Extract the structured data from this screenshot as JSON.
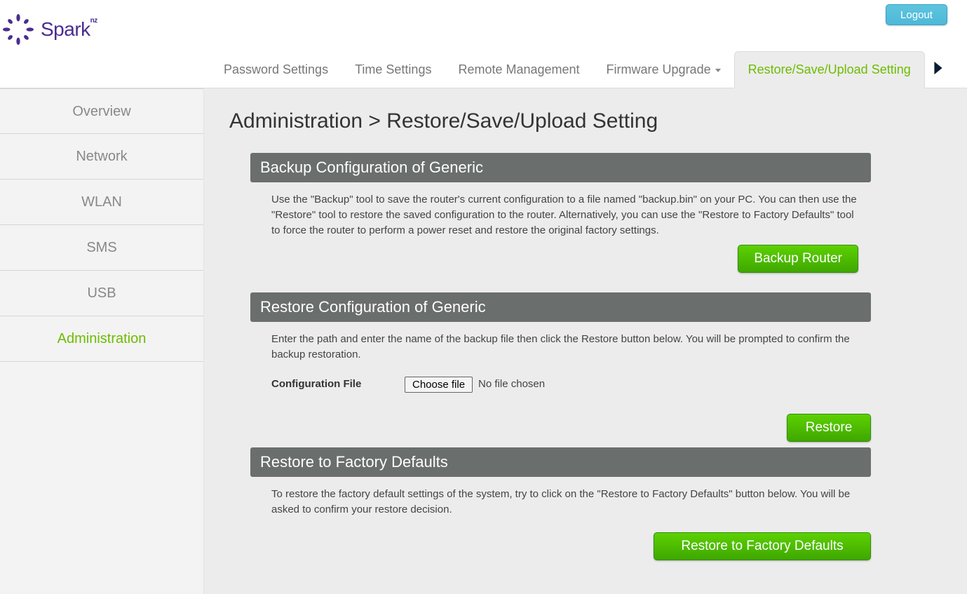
{
  "header": {
    "brand": "Spark",
    "brand_suffix": "nz",
    "logout": "Logout"
  },
  "tabs": [
    {
      "label": "Password Settings"
    },
    {
      "label": "Time Settings"
    },
    {
      "label": "Remote Management"
    },
    {
      "label": "Firmware Upgrade",
      "dropdown": true
    },
    {
      "label": "Restore/Save/Upload Setting",
      "active": true
    }
  ],
  "sidebar": [
    {
      "label": "Overview"
    },
    {
      "label": "Network"
    },
    {
      "label": "WLAN"
    },
    {
      "label": "SMS"
    },
    {
      "label": "USB"
    },
    {
      "label": "Administration",
      "active": true
    }
  ],
  "page": {
    "title": "Administration > Restore/Save/Upload Setting",
    "backup": {
      "heading": "Backup Configuration of Generic",
      "desc": "Use the \"Backup\" tool to save the router's current configuration to a file named \"backup.bin\" on your PC. You can then use the \"Restore\" tool to restore the saved configuration to the router. Alternatively, you can use the \"Restore to Factory Defaults\" tool to force the router to perform a power reset and restore the original factory settings.",
      "button": "Backup Router"
    },
    "restore": {
      "heading": "Restore Configuration of Generic",
      "desc": "Enter the path and enter the name of the backup file then click the Restore button below. You will be prompted to confirm the backup restoration.",
      "file_label": "Configuration File",
      "choose_btn": "Choose file",
      "no_file": "No file chosen",
      "button": "Restore"
    },
    "factory": {
      "heading": "Restore to Factory Defaults",
      "desc": "To restore the factory default settings of the system, try to click on the \"Restore to Factory Defaults\" button below. You will be asked to confirm your restore decision.",
      "button": "Restore to Factory Defaults"
    }
  }
}
